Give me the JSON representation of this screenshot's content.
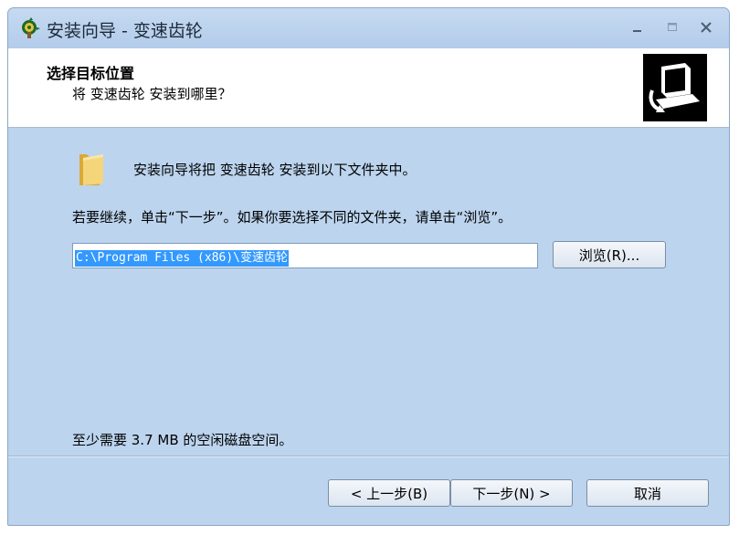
{
  "window": {
    "title": "安装向导 - 变速齿轮",
    "controls": {
      "minimize_icon": "minimize-icon",
      "maximize_icon": "maximize-icon",
      "close_icon": "close-icon"
    }
  },
  "header": {
    "title": "选择目标位置",
    "subtitle": "将 变速齿轮 安装到哪里？"
  },
  "content": {
    "description": "安装向导将把 变速齿轮 安装到以下文件夹中。",
    "instruction": "若要继续，单击“下一步”。如果你要选择不同的文件夹，请单击“浏览”。",
    "path_value": "C:\\Program Files (x86)\\变速齿轮",
    "browse_label": "浏览(R)...",
    "disk_space_text": "至少需要 3.7 MB 的空闲磁盘空间。"
  },
  "footer": {
    "back_label": "< 上一步(B)",
    "next_label": "下一步(N) >",
    "cancel_label": "取消"
  },
  "colors": {
    "window_bg": "#bcd4ee",
    "selection": "#3399ff"
  }
}
